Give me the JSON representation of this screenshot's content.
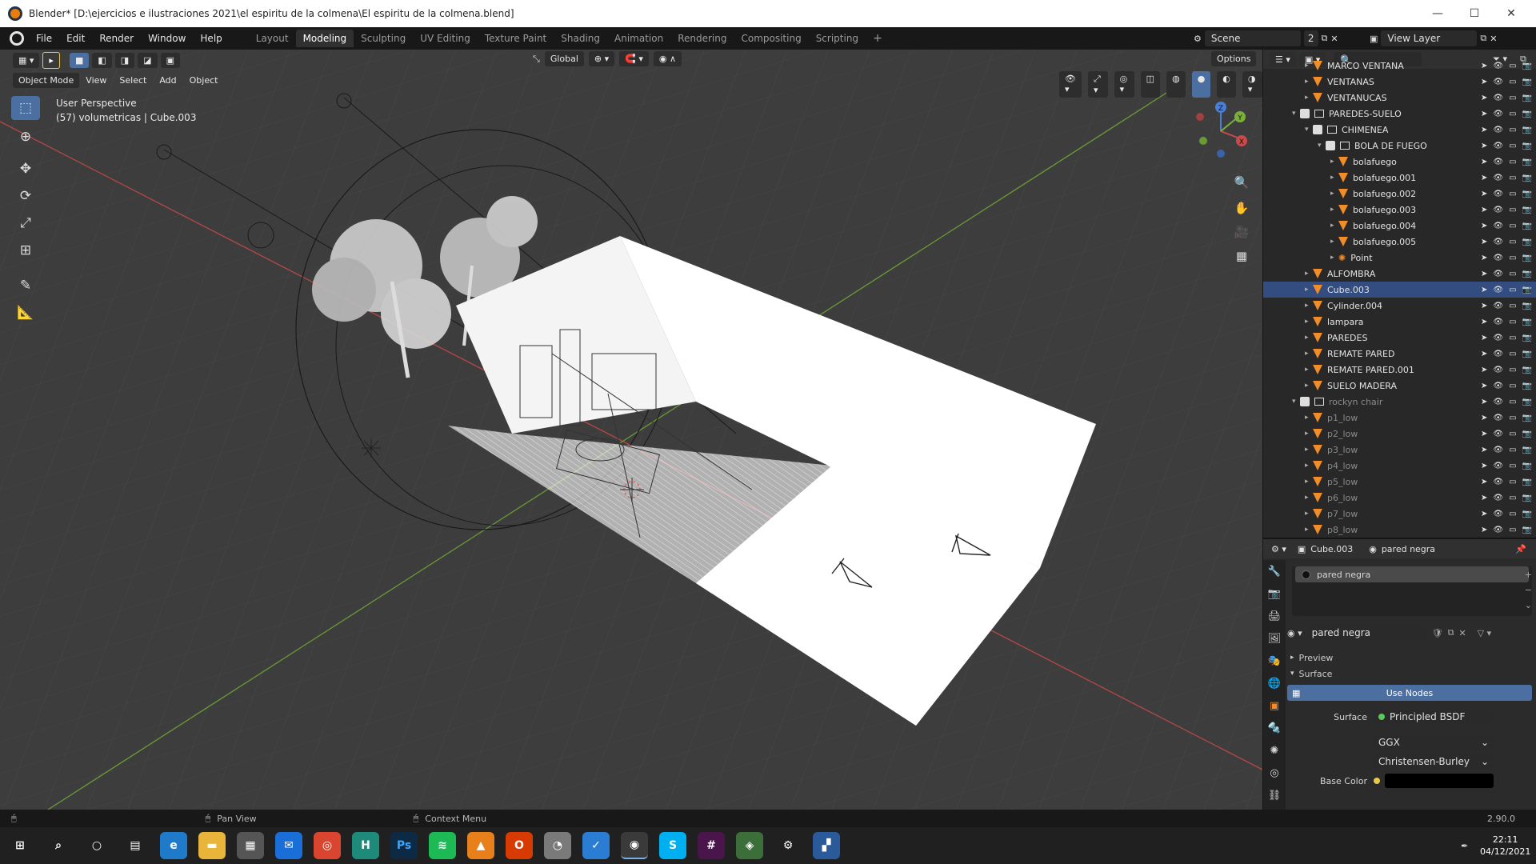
{
  "window": {
    "title": "Blender* [D:\\ejercicios e ilustraciones 2021\\el espiritu de la colmena\\El espiritu de la colmena.blend]",
    "minimize": "—",
    "maximize": "☐",
    "close": "✕"
  },
  "menu": [
    "File",
    "Edit",
    "Render",
    "Window",
    "Help"
  ],
  "workspaces": [
    "Layout",
    "Modeling",
    "Sculpting",
    "UV Editing",
    "Texture Paint",
    "Shading",
    "Animation",
    "Rendering",
    "Compositing",
    "Scripting"
  ],
  "workspace_add": "+",
  "scene": {
    "name": "Scene",
    "count": "2"
  },
  "view_layer": "View Layer",
  "viewport": {
    "mode": "Object Mode",
    "menus": [
      "View",
      "Select",
      "Add",
      "Object"
    ],
    "transform_orientation": "Global",
    "options": "Options",
    "info_line1": "User Perspective",
    "info_line2": "(57) volumetricas | Cube.003",
    "gizmo": {
      "x": "X",
      "y": "Y",
      "z": "Z"
    }
  },
  "outliner": {
    "rows": [
      {
        "name": "MARCO VENTANA",
        "type": "object",
        "indent": 0,
        "expanded": false
      },
      {
        "name": "VENTANAS",
        "type": "object",
        "indent": 0,
        "expanded": false
      },
      {
        "name": "VENTANUCAS",
        "type": "object",
        "indent": 0,
        "expanded": false
      },
      {
        "name": "PAREDES-SUELO",
        "type": "collection",
        "indent": -1,
        "expanded": true
      },
      {
        "name": "CHIMENEA",
        "type": "collection",
        "indent": 0,
        "expanded": true
      },
      {
        "name": "BOLA DE FUEGO",
        "type": "collection",
        "indent": 1,
        "expanded": true
      },
      {
        "name": "bolafuego",
        "type": "object",
        "indent": 2,
        "expanded": false
      },
      {
        "name": "bolafuego.001",
        "type": "object",
        "indent": 2,
        "expanded": false
      },
      {
        "name": "bolafuego.002",
        "type": "object",
        "indent": 2,
        "expanded": false
      },
      {
        "name": "bolafuego.003",
        "type": "object",
        "indent": 2,
        "expanded": false
      },
      {
        "name": "bolafuego.004",
        "type": "object",
        "indent": 2,
        "expanded": false
      },
      {
        "name": "bolafuego.005",
        "type": "object",
        "indent": 2,
        "expanded": false
      },
      {
        "name": "Point",
        "type": "light",
        "indent": 2,
        "expanded": false
      },
      {
        "name": "ALFOMBRA",
        "type": "object",
        "indent": 0,
        "expanded": false
      },
      {
        "name": "Cube.003",
        "type": "object",
        "indent": 0,
        "expanded": false,
        "selected": true
      },
      {
        "name": "Cylinder.004",
        "type": "object",
        "indent": 0,
        "expanded": false
      },
      {
        "name": "lampara",
        "type": "object",
        "indent": 0,
        "expanded": false
      },
      {
        "name": "PAREDES",
        "type": "object",
        "indent": 0,
        "expanded": false
      },
      {
        "name": "REMATE PARED",
        "type": "object",
        "indent": 0,
        "expanded": false
      },
      {
        "name": "REMATE PARED.001",
        "type": "object",
        "indent": 0,
        "expanded": false
      },
      {
        "name": "SUELO MADERA",
        "type": "object",
        "indent": 0,
        "expanded": false
      },
      {
        "name": "rockyn chair",
        "type": "collection",
        "indent": -1,
        "expanded": true,
        "dim": true
      },
      {
        "name": "p1_low",
        "type": "object",
        "indent": 0,
        "dim": true
      },
      {
        "name": "p2_low",
        "type": "object",
        "indent": 0,
        "dim": true
      },
      {
        "name": "p3_low",
        "type": "object",
        "indent": 0,
        "dim": true
      },
      {
        "name": "p4_low",
        "type": "object",
        "indent": 0,
        "dim": true
      },
      {
        "name": "p5_low",
        "type": "object",
        "indent": 0,
        "dim": true
      },
      {
        "name": "p6_low",
        "type": "object",
        "indent": 0,
        "dim": true
      },
      {
        "name": "p7_low",
        "type": "object",
        "indent": 0,
        "dim": true
      },
      {
        "name": "p8_low",
        "type": "object",
        "indent": 0,
        "dim": true
      }
    ]
  },
  "properties": {
    "object": "Cube.003",
    "material": "pared negra",
    "slot": "pared negra",
    "material_field": "pared negra",
    "preview": "Preview",
    "surface_panel": "Surface",
    "use_nodes": "Use Nodes",
    "surface_label": "Surface",
    "surface_value": "Principled BSDF",
    "distribution": "GGX",
    "subsurface": "Christensen-Burley",
    "base_color_label": "Base Color",
    "base_color": "#000000"
  },
  "status": {
    "pan": "Pan View",
    "context": "Context Menu",
    "version": "2.90.0"
  },
  "taskbar": {
    "time": "22:11",
    "date": "04/12/2021"
  },
  "colors": {
    "accent": "#4a6fa0",
    "selected_row": "#334d80",
    "object_icon": "#f08c2a",
    "x_axis": "#c94a4a",
    "y_axis": "#7ab03a",
    "z_axis": "#4a7fd6"
  }
}
